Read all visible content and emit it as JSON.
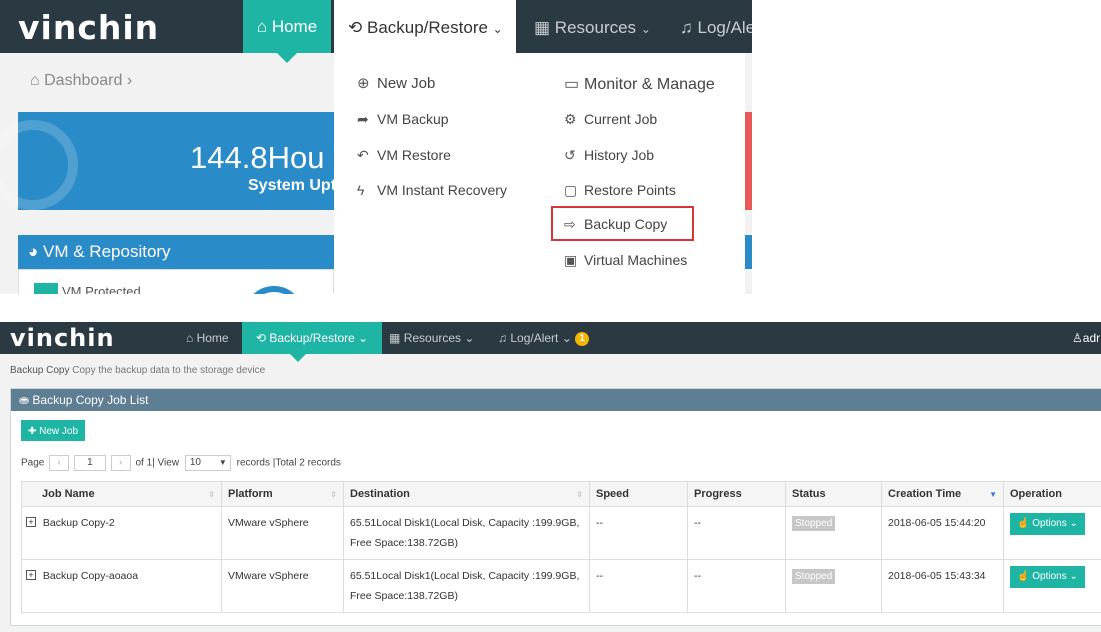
{
  "top": {
    "logo": "vinchin",
    "nav": {
      "home": "Home",
      "backup_restore": "Backup/Restore",
      "resources": "Resources",
      "log_alert": "Log/Ale"
    },
    "breadcrumb": "Dashboard",
    "uptime_value": "144.8Hou",
    "uptime_label": "System Upt",
    "vm_repository": "VM & Repository",
    "vm_protected": "VM Protected",
    "dropdown": {
      "left": [
        "New Job",
        "VM Backup",
        "VM Restore",
        "VM Instant Recovery"
      ],
      "right": [
        "Monitor & Manage",
        "Current Job",
        "History Job",
        "Restore Points",
        "Backup Copy",
        "Virtual Machines"
      ]
    }
  },
  "bottom": {
    "logo": "vinchin",
    "nav": {
      "home": "Home",
      "backup_restore": "Backup/Restore",
      "resources": "Resources",
      "log_alert": "Log/Alert",
      "alert_count": "1",
      "user": "adr"
    },
    "subtitle_title": "Backup Copy",
    "subtitle_desc": "Copy the backup data to the storage device",
    "panel_title": "Backup Copy Job List",
    "new_job": "New Job",
    "pager": {
      "page_label": "Page",
      "page_value": "1",
      "of_text": "of 1| View",
      "view_value": "10",
      "records_text": "records |Total 2 records"
    },
    "table": {
      "columns": [
        "Job Name",
        "Platform",
        "Destination",
        "Speed",
        "Progress",
        "Status",
        "Creation Time",
        "Operation"
      ],
      "rows": [
        {
          "job_name": "Backup Copy-2",
          "platform": "VMware vSphere",
          "destination": "65.51Local Disk1(Local Disk, Capacity :199.9GB, Free Space:138.72GB)",
          "speed": "--",
          "progress": "--",
          "status": "Stopped",
          "creation_time": "2018-06-05 15:44:20",
          "operation": "Options"
        },
        {
          "job_name": "Backup Copy-aoaoa",
          "platform": "VMware vSphere",
          "destination": "65.51Local Disk1(Local Disk, Capacity :199.9GB, Free Space:138.72GB)",
          "speed": "--",
          "progress": "--",
          "status": "Stopped",
          "creation_time": "2018-06-05 15:43:34",
          "operation": "Options"
        }
      ]
    }
  },
  "colors": {
    "nav_bg": "#2b3a42",
    "accent": "#1fb5a5",
    "panel_head": "#5e7e94",
    "highlight_border": "#d9343a",
    "card_blue": "#2a8bc9"
  },
  "icons": [
    "home-icon",
    "sync-icon",
    "grid-icon",
    "bell-icon",
    "plus-circle-icon",
    "share-icon",
    "undo-icon",
    "bolt-icon",
    "laptop-icon",
    "gears-icon",
    "history-icon",
    "monitor-icon",
    "copy-icon",
    "vm-icon",
    "user-icon",
    "chevron-down-icon"
  ]
}
